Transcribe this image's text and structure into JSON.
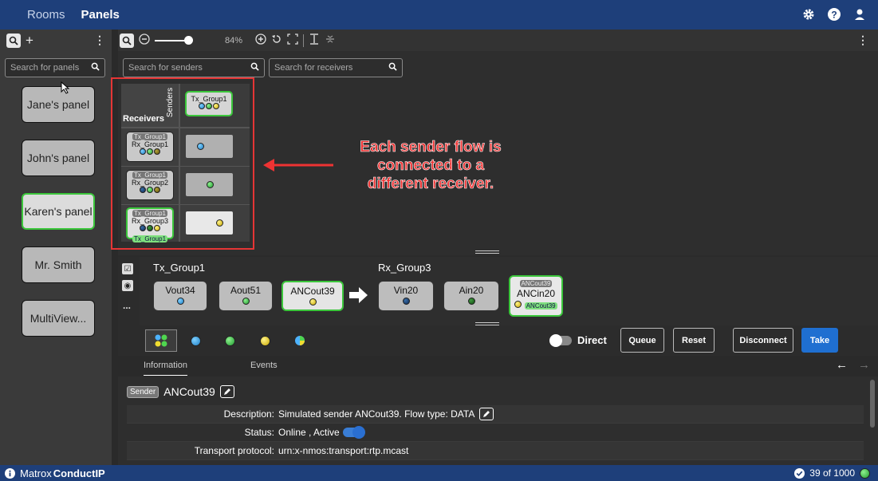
{
  "topbar": {
    "tabs": [
      "Rooms",
      "Panels"
    ],
    "icons": [
      "gear-icon",
      "help-icon",
      "user-icon"
    ]
  },
  "left": {
    "add_symbol": "+",
    "kebab": "⋮",
    "search_placeholder": "Search for panels",
    "panels": [
      "Jane's panel",
      "John's panel",
      "Karen's panel",
      "Mr. Smith",
      "MultiView..."
    ]
  },
  "toolbar": {
    "zoom": "84%",
    "kebab": "⋮"
  },
  "search": {
    "senders_placeholder": "Search for senders",
    "receivers_placeholder": "Search for receivers"
  },
  "grid": {
    "receivers_label": "Receivers",
    "senders_label": "Senders",
    "sender": {
      "name": "Tx_Group1",
      "dots": [
        "blue",
        "green",
        "yellow"
      ]
    },
    "rows": [
      {
        "tag": "Tx_Group1",
        "name": "Rx_Group1",
        "dots": [
          "blue",
          "green",
          "olive"
        ],
        "flow": "blue"
      },
      {
        "tag": "Tx_Group1",
        "name": "Rx_Group2",
        "dots": [
          "navy",
          "green",
          "olive"
        ],
        "flow": "green"
      },
      {
        "tag": "Tx_Group1",
        "name": "Rx_Group3",
        "dots": [
          "navy",
          "dgreen",
          "yellow"
        ],
        "flow": "yellow",
        "bottom_tag": "Tx_Group1"
      }
    ]
  },
  "annotation": {
    "lines": [
      "Each sender flow is",
      "connected to a",
      "different receiver."
    ]
  },
  "route": {
    "sender_group": "Tx_Group1",
    "receiver_group": "Rx_Group3",
    "senders": [
      {
        "name": "Vout34",
        "dot": "blue"
      },
      {
        "name": "Aout51",
        "dot": "green"
      },
      {
        "name": "ANCout39",
        "dot": "yellow"
      }
    ],
    "receivers": [
      {
        "name": "Vin20",
        "dot": "navy"
      },
      {
        "name": "Ain20",
        "dot": "dgreen"
      },
      {
        "name": "ANCin20",
        "dot": "yellow",
        "top_tag": "ANCout39",
        "bottom_tag": "ANCout39"
      }
    ],
    "side_more": "..."
  },
  "actions": {
    "direct": "Direct",
    "queue": "Queue",
    "reset": "Reset",
    "disconnect": "Disconnect",
    "take": "Take"
  },
  "info": {
    "tabs": [
      "Information",
      "Events"
    ],
    "sender_tag": "Sender",
    "sender_name": "ANCout39",
    "rows": [
      {
        "key": "Description:",
        "value": "Simulated sender ANCout39. Flow type: DATA"
      },
      {
        "key": "Status:",
        "value": "Online , Active"
      },
      {
        "key": "Transport protocol:",
        "value": "urn:x-nmos:transport:rtp.mcast"
      }
    ]
  },
  "footer": {
    "brand": "Matrox",
    "product": "ConductIP",
    "count": "39 of 1000"
  },
  "colors": {
    "topbar": "#1e3f7a",
    "active_border": "#3bc63b",
    "annotation": "#e33333",
    "take": "#1f6fd1"
  }
}
